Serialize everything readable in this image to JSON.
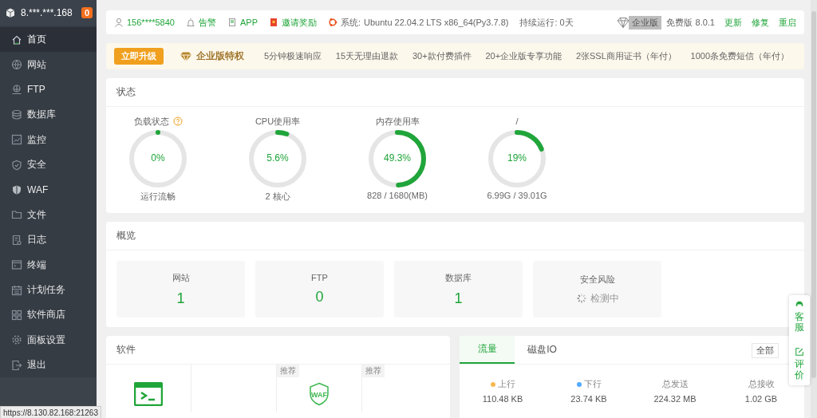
{
  "sidebar": {
    "host": "8.***.***.168",
    "badge": "0",
    "items": [
      {
        "label": "首页",
        "selected": true
      },
      {
        "label": "网站",
        "selected": false
      },
      {
        "label": "FTP",
        "selected": false
      },
      {
        "label": "数据库",
        "selected": false
      },
      {
        "label": "监控",
        "selected": false
      },
      {
        "label": "安全",
        "selected": false
      },
      {
        "label": "WAF",
        "selected": false
      },
      {
        "label": "文件",
        "selected": false
      },
      {
        "label": "日志",
        "selected": false
      },
      {
        "label": "终端",
        "selected": false
      },
      {
        "label": "计划任务",
        "selected": false
      },
      {
        "label": "软件商店",
        "selected": false
      },
      {
        "label": "面板设置",
        "selected": false
      },
      {
        "label": "退出",
        "selected": false
      }
    ]
  },
  "topbar": {
    "account": "156****5840",
    "alarm": "告警",
    "app": "APP",
    "invite": "邀请奖励",
    "system_label": "系统:",
    "system": "Ubuntu 22.04.2 LTS x86_64(Py3.7.8)",
    "uptime": "持续运行: 0天",
    "edition_tag": "企业版",
    "version": "免费版 8.0.1",
    "actions": [
      "更新",
      "修复",
      "重启"
    ]
  },
  "promo": {
    "button": "立即升级",
    "title": "企业版特权",
    "features": [
      "5分钟极速响应",
      "15天无理由退款",
      "30+款付费插件",
      "20+企业版专享功能",
      "2张SSL商用证书（年付）",
      "1000条免费短信（年付）"
    ]
  },
  "status": {
    "title": "状态",
    "gauges": [
      {
        "title": "负载状态",
        "help": true,
        "value": "0%",
        "level": 0,
        "detail": "运行流畅"
      },
      {
        "title": "CPU使用率",
        "help": false,
        "value": "5.6%",
        "level": 0.056,
        "detail": "2 核心"
      },
      {
        "title": "内存使用率",
        "help": false,
        "value": "49.3%",
        "level": 0.493,
        "detail": "828 / 1680(MB)"
      },
      {
        "title": "/",
        "help": false,
        "value": "19%",
        "level": 0.19,
        "detail": "6.99G / 39.01G"
      }
    ]
  },
  "overview": {
    "title": "概览",
    "items": [
      {
        "kind": "count",
        "label": "网站",
        "value": "1"
      },
      {
        "kind": "count",
        "label": "FTP",
        "value": "0"
      },
      {
        "kind": "count",
        "label": "数据库",
        "value": "1"
      },
      {
        "kind": "loading",
        "label": "安全风险",
        "value": "检测中"
      }
    ]
  },
  "software": {
    "title": "软件",
    "tiles": [
      {
        "kind": "terminal"
      },
      {
        "kind": "empty"
      },
      {
        "kind": "waf",
        "tag": "推荐",
        "icon_text": "WAF"
      },
      {
        "kind": "empty",
        "tag": "推荐"
      }
    ]
  },
  "traffic": {
    "tabs": [
      {
        "label": "流量",
        "selected": true
      },
      {
        "label": "磁盘IO",
        "selected": false
      }
    ],
    "range": "全部",
    "stats": [
      {
        "label": "上行",
        "color": "#f7b851",
        "value": "110.48 KB"
      },
      {
        "label": "下行",
        "color": "#52a9ff",
        "value": "23.74 KB"
      },
      {
        "label": "总发送",
        "value": "224.32 MB"
      },
      {
        "label": "总接收",
        "value": "1.02 GB"
      }
    ]
  },
  "float_panel": [
    "客服",
    "评价"
  ],
  "status_tooltip": "https://8.130.82.168:21263"
}
